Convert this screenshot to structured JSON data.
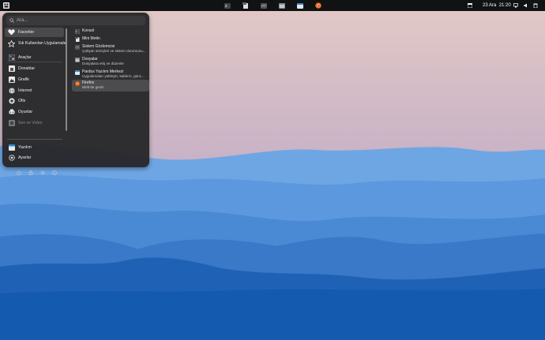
{
  "search": {
    "placeholder": "Ara..."
  },
  "categories": [
    {
      "label": "Favoriler",
      "icon": "heart-icon"
    },
    {
      "label": "Sık Kullanılan Uygulamalar",
      "icon": "star-icon"
    },
    {
      "label": "Araçlar",
      "icon": "tools-icon"
    },
    {
      "label": "Donatılar",
      "icon": "accessories-icon"
    },
    {
      "label": "Grafik",
      "icon": "graphics-icon"
    },
    {
      "label": "İnternet",
      "icon": "globe-icon"
    },
    {
      "label": "Ofis",
      "icon": "office-icon"
    },
    {
      "label": "Oyunlar",
      "icon": "gamepad-icon"
    },
    {
      "label": "Ses ve Video",
      "icon": "multimedia-icon"
    },
    {
      "label": "Yazılım",
      "icon": "software-center-icon"
    },
    {
      "label": "Ayarlar",
      "icon": "settings-icon"
    }
  ],
  "apps": [
    {
      "name": "Konsol",
      "desc": ""
    },
    {
      "name": "Mini Metin",
      "desc": ""
    },
    {
      "name": "Sistem Gözlemcisi",
      "desc": "Çalışan süreçleri ve sistem durumunu..."
    },
    {
      "name": "Dosyalar",
      "desc": "Dosyalara eriş ve düzenle"
    },
    {
      "name": "Pardus Yazılım Merkezi",
      "desc": "Uygulamaları yükleyin, kaldırın, günc..."
    },
    {
      "name": "Firefox",
      "desc": "Web'de gezin"
    }
  ],
  "clock": {
    "date": "23 Ara",
    "time": "21:20"
  },
  "colors": {
    "accent": "#3d8ee0",
    "menu_bg": "#28282a",
    "panel_bg": "#111214"
  }
}
